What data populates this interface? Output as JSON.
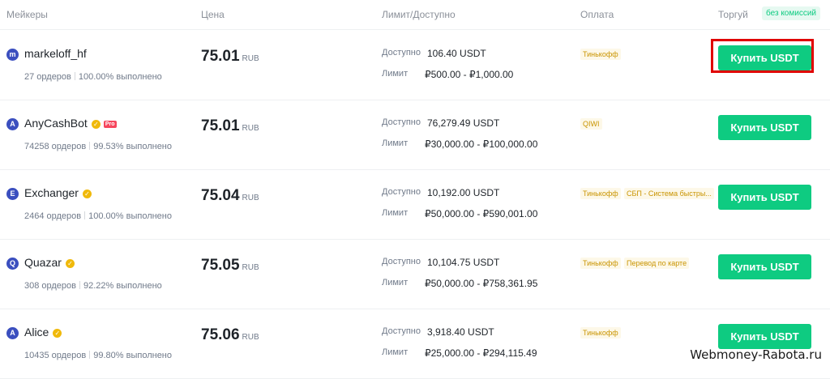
{
  "header": {
    "makers": "Мейкеры",
    "price": "Цена",
    "limit": "Лимит/Доступно",
    "payment": "Оплата",
    "trade": "Торгуй",
    "badge": "без комиссий"
  },
  "rows": [
    {
      "avatar": "m",
      "name": "markeloff_hf",
      "verified": false,
      "pro": false,
      "orders": "27 ордеров",
      "completion": "100.00% выполнено",
      "price": "75.01",
      "currency": "RUB",
      "available_label": "Доступно",
      "available": "106.40 USDT",
      "limit_label": "Лимит",
      "limit": "₽500.00 - ₽1,000.00",
      "payments": [
        "Тинькофф"
      ],
      "button": "Купить USDT"
    },
    {
      "avatar": "A",
      "name": "AnyCashBot",
      "verified": true,
      "pro": true,
      "pro_label": "Pro",
      "orders": "74258 ордеров",
      "completion": "99.53% выполнено",
      "price": "75.01",
      "currency": "RUB",
      "available_label": "Доступно",
      "available": "76,279.49 USDT",
      "limit_label": "Лимит",
      "limit": "₽30,000.00 - ₽100,000.00",
      "payments": [
        "QIWI"
      ],
      "button": "Купить USDT"
    },
    {
      "avatar": "E",
      "name": "Exchanger",
      "verified": true,
      "pro": false,
      "orders": "2464 ордеров",
      "completion": "100.00% выполнено",
      "price": "75.04",
      "currency": "RUB",
      "available_label": "Доступно",
      "available": "10,192.00 USDT",
      "limit_label": "Лимит",
      "limit": "₽50,000.00 - ₽590,001.00",
      "payments": [
        "Тинькофф",
        "СБП - Система быстры..."
      ],
      "button": "Купить USDT"
    },
    {
      "avatar": "Q",
      "name": "Quazar",
      "verified": true,
      "pro": false,
      "orders": "308 ордеров",
      "completion": "92.22% выполнено",
      "price": "75.05",
      "currency": "RUB",
      "available_label": "Доступно",
      "available": "10,104.75 USDT",
      "limit_label": "Лимит",
      "limit": "₽50,000.00 - ₽758,361.95",
      "payments": [
        "Тинькофф",
        "Перевод по карте"
      ],
      "button": "Купить USDT"
    },
    {
      "avatar": "A",
      "name": "Alice",
      "verified": true,
      "pro": false,
      "orders": "10435 ордеров",
      "completion": "99.80% выполнено",
      "price": "75.06",
      "currency": "RUB",
      "available_label": "Доступно",
      "available": "3,918.40 USDT",
      "limit_label": "Лимит",
      "limit": "₽25,000.00 - ₽294,115.49",
      "payments": [
        "Тинькофф"
      ],
      "button": "Купить USDT"
    }
  ],
  "watermark": "Webmoney-Rabota.ru",
  "colors": {
    "buy_button": "#0ecb81",
    "highlight": "#e00000",
    "verified_badge": "#f0b90b",
    "avatar": "#3b4fbf"
  },
  "icons": {
    "verified": "verified-check-icon",
    "avatar": "user-avatar-icon"
  }
}
